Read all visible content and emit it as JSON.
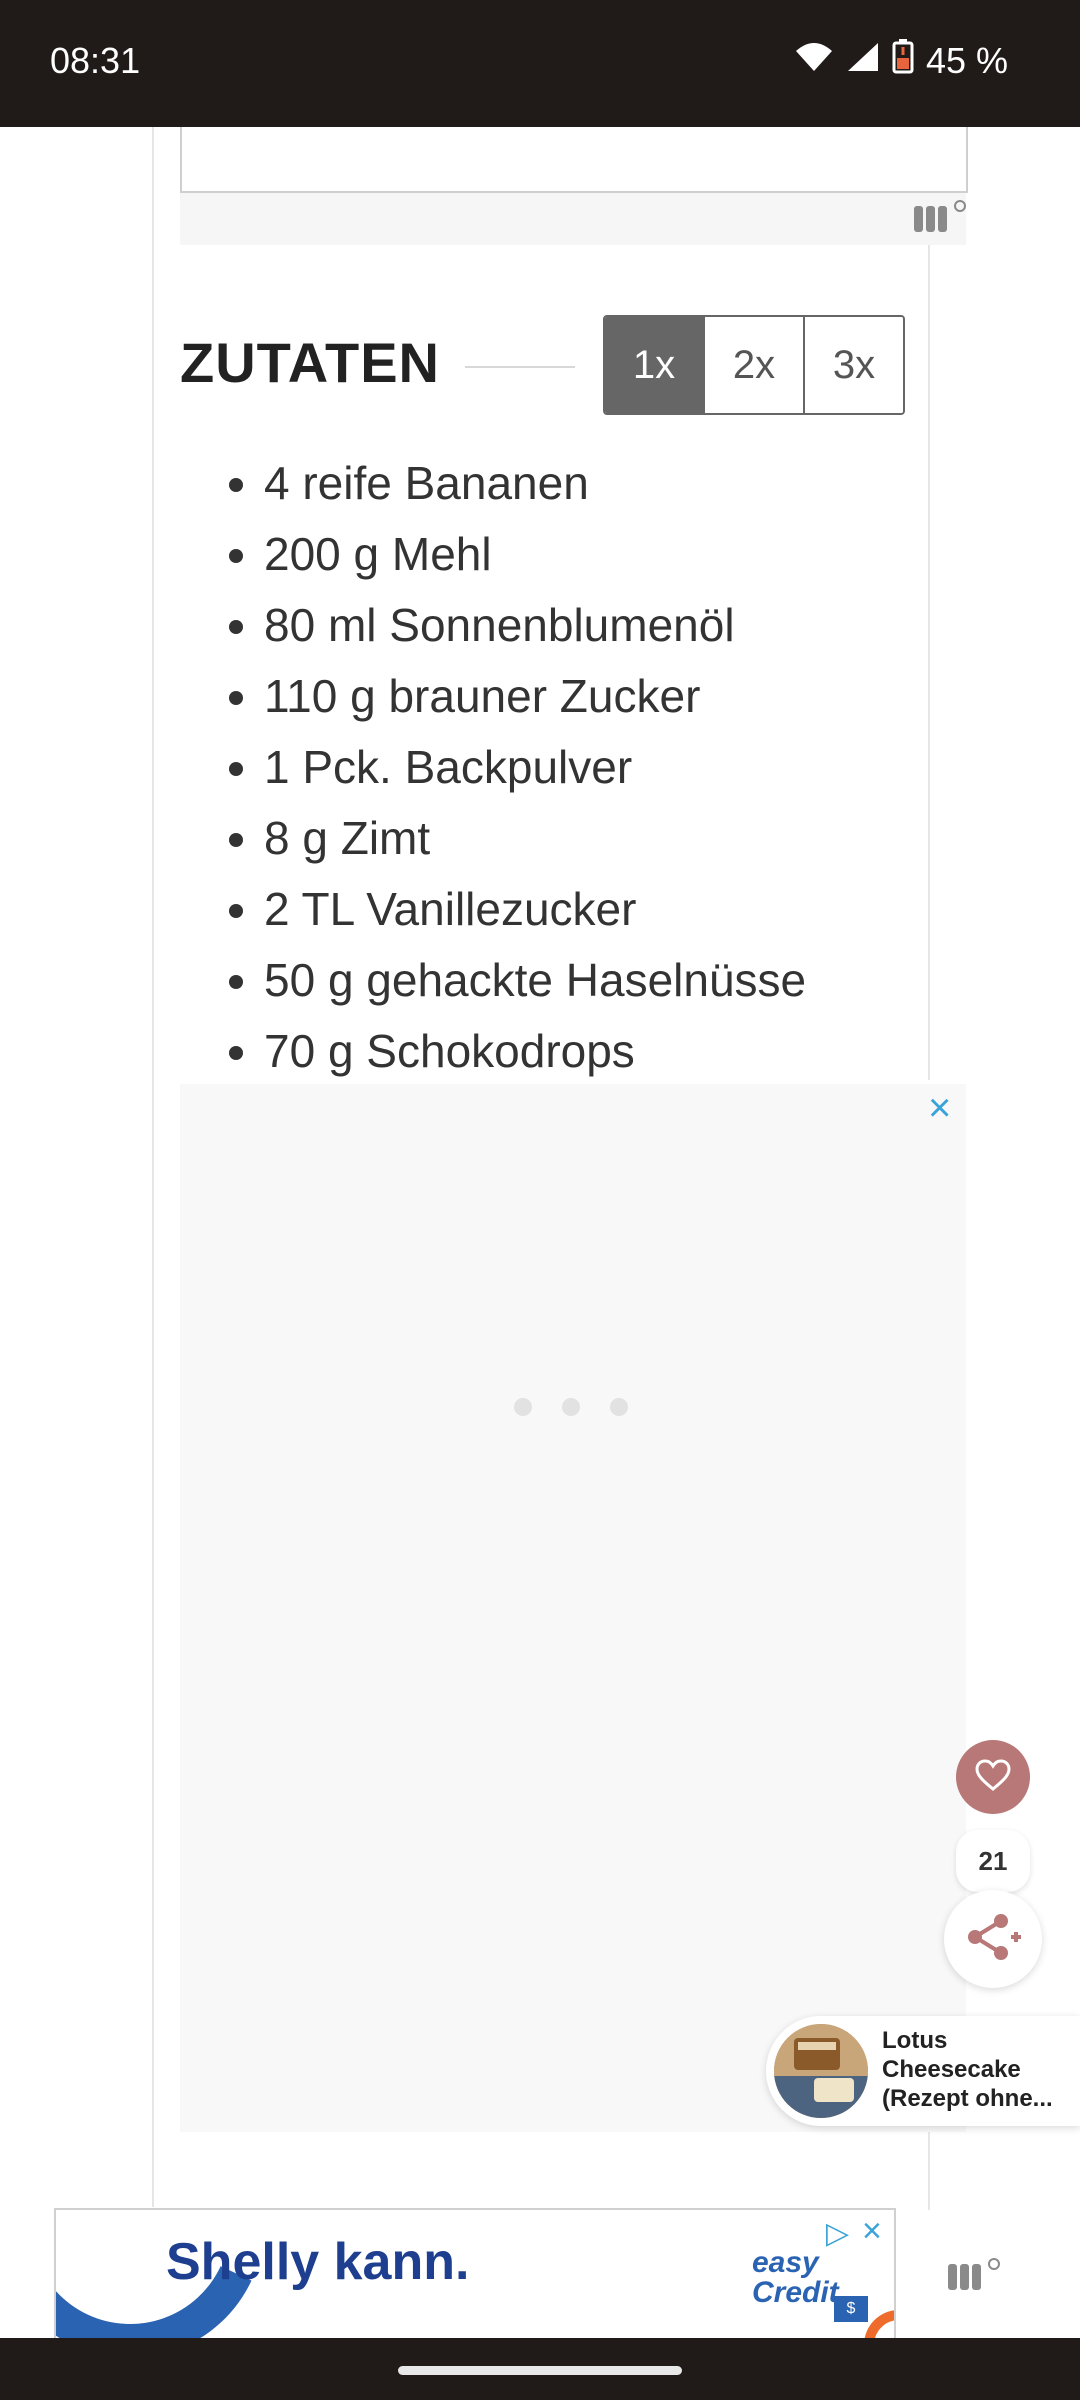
{
  "status_bar": {
    "time": "08:31",
    "battery_percent": "45 %",
    "icons": [
      "wifi-icon",
      "cell-signal-icon",
      "battery-low-icon"
    ]
  },
  "ingredients_section": {
    "heading": "ZUTATEN",
    "servings": [
      {
        "label": "1x",
        "selected": true
      },
      {
        "label": "2x",
        "selected": false
      },
      {
        "label": "3x",
        "selected": false
      }
    ],
    "items": [
      "4 reife Bananen",
      "200 g Mehl",
      "80 ml Sonnenblumenöl",
      "110 g brauner Zucker",
      "1 Pck. Backpulver",
      "8 g Zimt",
      "2 TL Vanillezucker",
      "50 g gehackte Haselnüsse",
      "70 g Schokodrops"
    ]
  },
  "ad": {
    "close_icon": "×",
    "loading_icon": "loading-dots-icon"
  },
  "floating_actions": {
    "favorite_icon": "heart-icon",
    "favorite_count": "21",
    "share_icon": "share-plus-icon"
  },
  "related_recipe": {
    "title_line1": "Lotus",
    "title_line2": "Cheesecake",
    "title_line3": "(Rezept ohne..."
  },
  "bottom_banner": {
    "slogan": "Shelly kann.",
    "brand_line1": "easy",
    "brand_line2": "Credit",
    "adchoices_icon": "▷",
    "close_icon": "×"
  },
  "colors": {
    "status_bar_bg": "#201b18",
    "servings_active": "#666666",
    "heart_button": "#b87878",
    "ad_close": "#3aa3d8",
    "banner_blue": "#2b63b3"
  }
}
